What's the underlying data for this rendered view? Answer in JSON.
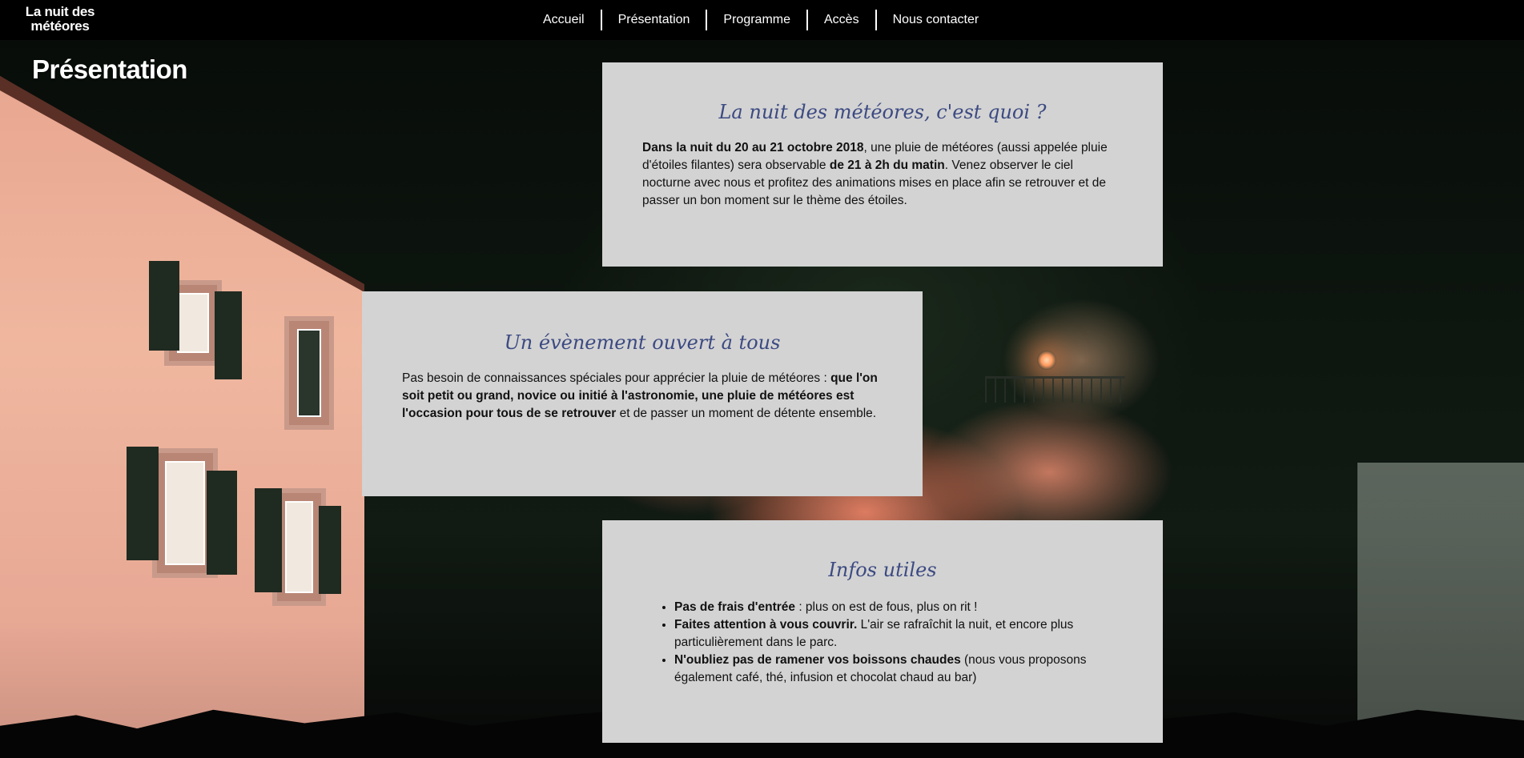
{
  "header": {
    "logo_line1": "La nuit des",
    "logo_line2": "météores",
    "nav": [
      "Accueil",
      "Présentation",
      "Programme",
      "Accès",
      "Nous contacter"
    ]
  },
  "page": {
    "title": "Présentation"
  },
  "sections": [
    {
      "title": "La nuit des météores, c'est quoi ?",
      "text": [
        {
          "bold": true,
          "t": "Dans la nuit du 20 au 21 octobre 2018"
        },
        {
          "bold": false,
          "t": ", une pluie de météores (aussi appelée pluie d'étoiles filantes) sera observable "
        },
        {
          "bold": true,
          "t": "de 21 à 2h du matin"
        },
        {
          "bold": false,
          "t": ". Venez observer le ciel nocturne avec nous et profitez des animations mises en place afin se retrouver et de passer un bon moment sur le thème des étoiles."
        }
      ]
    },
    {
      "title": "Un évènement ouvert à tous",
      "text": [
        {
          "bold": false,
          "t": "Pas besoin de connaissances spéciales pour apprécier la pluie de météores : "
        },
        {
          "bold": true,
          "t": "que l'on soit petit ou grand, novice ou initié à l'astronomie, une pluie de météores est l'occasion pour tous de se retrouver"
        },
        {
          "bold": false,
          "t": " et de passer un moment de détente ensemble."
        }
      ]
    },
    {
      "title": "Infos utiles",
      "items": [
        [
          {
            "bold": true,
            "t": "Pas de frais d'entrée"
          },
          {
            "bold": false,
            "t": " : plus on est de fous, plus on rit !"
          }
        ],
        [
          {
            "bold": true,
            "t": "Faites attention à vous couvrir."
          },
          {
            "bold": false,
            "t": " L'air se rafraîchit la nuit, et encore plus particulièrement dans le parc."
          }
        ],
        [
          {
            "bold": true,
            "t": "N'oubliez pas de ramener vos boissons chaudes"
          },
          {
            "bold": false,
            "t": " (nous vous proposons également café, thé, infusion et chocolat chaud au bar)"
          }
        ]
      ]
    }
  ],
  "colors": {
    "header_bg": "#000000",
    "card_bg": "#d3d3d3",
    "heading": "#3c4a82"
  }
}
